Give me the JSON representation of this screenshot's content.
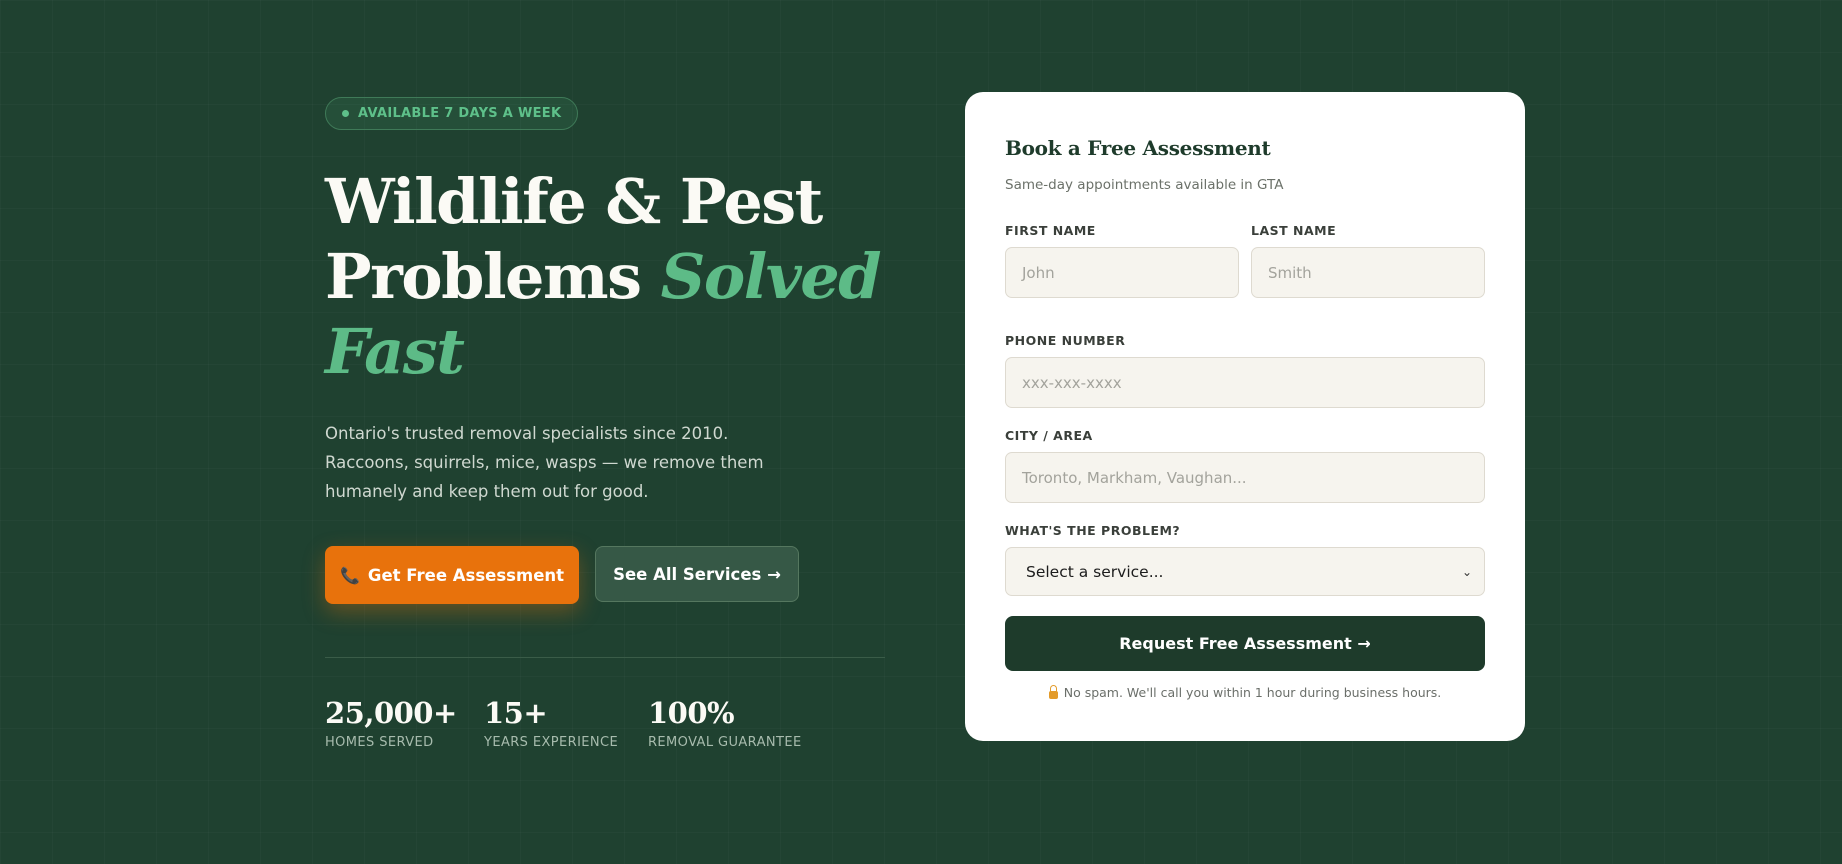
{
  "hero": {
    "badge": "AVAILABLE 7 DAYS A WEEK",
    "headline_line1": "Wildlife & Pest",
    "headline_line2_plain": "Problems",
    "headline_accent_part1": "Solved",
    "headline_accent_part2": "Fast",
    "lede": "Ontario's trusted removal specialists since 2010. Raccoons, squirrels, mice, wasps — we remove them humanely and keep them out for good.",
    "primary_button": "Get Free Assessment",
    "secondary_button": "See All Services →",
    "stats": [
      {
        "value": "25,000+",
        "label": "HOMES SERVED"
      },
      {
        "value": "15+",
        "label": "YEARS EXPERIENCE"
      },
      {
        "value": "100%",
        "label": "REMOVAL GUARANTEE"
      }
    ]
  },
  "form": {
    "title": "Book a Free Assessment",
    "subtitle": "Same-day appointments available in GTA",
    "first_name_label": "FIRST NAME",
    "first_name_placeholder": "John",
    "last_name_label": "LAST NAME",
    "last_name_placeholder": "Smith",
    "phone_label": "PHONE NUMBER",
    "phone_placeholder": "xxx-xxx-xxxx",
    "city_label": "CITY / AREA",
    "city_placeholder": "Toronto, Markham, Vaughan...",
    "problem_label": "WHAT'S THE PROBLEM?",
    "problem_selected": "Select a service...",
    "submit": "Request Free Assessment →",
    "disclaimer": "No spam. We'll call you within 1 hour during business hours."
  },
  "icons": {
    "badge_dot": "status-dot-icon",
    "primary_button_icon": "phone-icon",
    "select_icon": "chevron-down-icon",
    "disclaimer_icon": "lock-icon"
  },
  "colors": {
    "background": "#1f4130",
    "accent_green": "#5dbb87",
    "primary_orange": "#e8720c",
    "card_dark_green": "#1e3b2b"
  }
}
